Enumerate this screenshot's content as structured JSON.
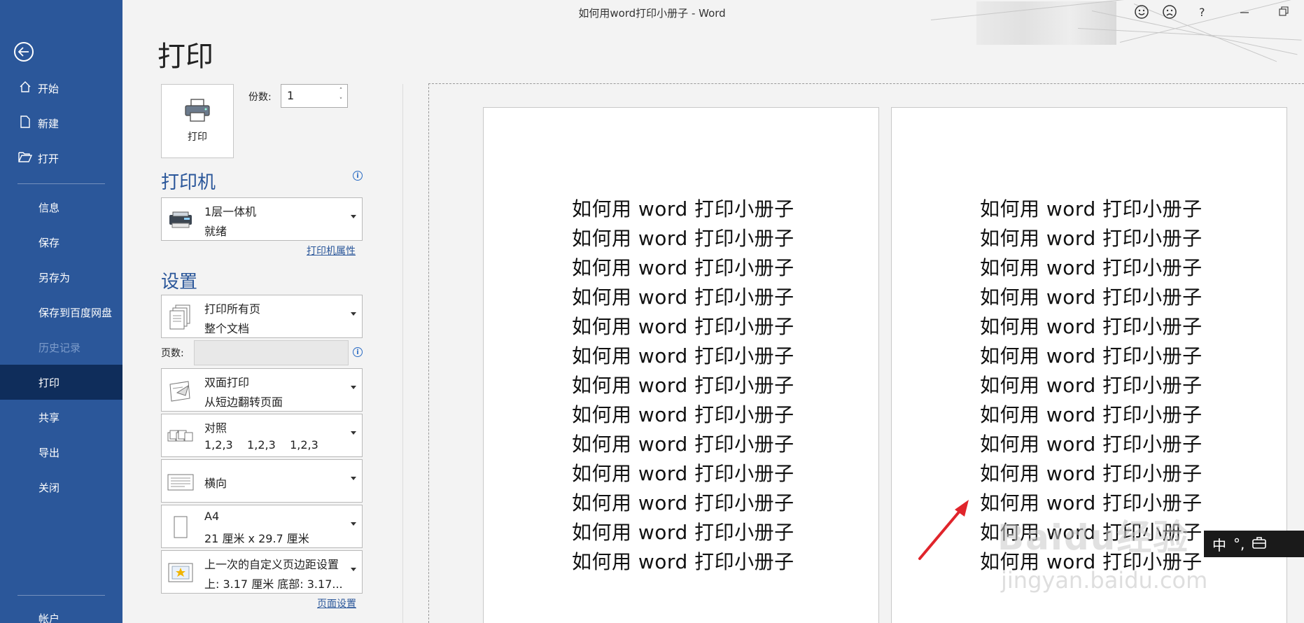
{
  "window": {
    "title": "如何用word打印小册子 - Word",
    "icons": [
      "smile-icon",
      "frown-icon",
      "help-icon",
      "minimize-icon",
      "restore-icon"
    ],
    "help_glyph": "?"
  },
  "sidebar": {
    "back_icon": "back-arrow-icon",
    "items": [
      {
        "label": "开始",
        "icon": "home-icon"
      },
      {
        "label": "新建",
        "icon": "new-document-icon"
      },
      {
        "label": "打开",
        "icon": "open-folder-icon"
      },
      {
        "label": "信息"
      },
      {
        "label": "保存"
      },
      {
        "label": "另存为"
      },
      {
        "label": "保存到百度网盘"
      },
      {
        "label": "历史记录"
      },
      {
        "label": "打印"
      },
      {
        "label": "共享"
      },
      {
        "label": "导出"
      },
      {
        "label": "关闭"
      },
      {
        "label": "帐户"
      }
    ],
    "active": "打印",
    "colors": {
      "bg": "#2b579a",
      "active": "#0f2d5b"
    }
  },
  "print_panel": {
    "heading": "打印",
    "print_button": "打印",
    "copies_label": "份数:",
    "copies_value": "1",
    "printer_section": "打印机",
    "printer": {
      "name": "1层一体机",
      "status": "就绪"
    },
    "printer_properties": "打印机属性",
    "settings_section": "设置",
    "range": {
      "line1": "打印所有页",
      "line2": "整个文档"
    },
    "pages_label": "页数:",
    "pages_value": "",
    "duplex": {
      "line1": "双面打印",
      "line2": "从短边翻转页面"
    },
    "collate": {
      "line1": "对照",
      "line2": "1,2,3    1,2,3    1,2,3"
    },
    "orientation": {
      "line1": "横向"
    },
    "paper": {
      "line1": "A4",
      "line2": "21 厘米 x 29.7 厘米"
    },
    "margins": {
      "line1": "上一次的自定义页边距设置",
      "line2": "上: 3.17 厘米 底部: 3.17..."
    },
    "page_setup": "页面设置"
  },
  "preview": {
    "left_page_lines": [
      "如何用 word 打印小册子",
      "如何用 word 打印小册子",
      "如何用 word 打印小册子",
      "如何用 word 打印小册子",
      "如何用 word 打印小册子",
      "如何用 word 打印小册子",
      "如何用 word 打印小册子",
      "如何用 word 打印小册子",
      "如何用 word 打印小册子",
      "如何用 word 打印小册子",
      "如何用 word 打印小册子",
      "如何用 word 打印小册子",
      "如何用 word 打印小册子"
    ],
    "right_page_lines": [
      "如何用 word 打印小册子",
      "如何用 word 打印小册子",
      "如何用 word 打印小册子",
      "如何用 word 打印小册子",
      "如何用 word 打印小册子",
      "如何用 word 打印小册子",
      "如何用 word 打印小册子",
      "如何用 word 打印小册子",
      "如何用 word 打印小册子",
      "如何用 word 打印小册子",
      "如何用 word 打印小册子",
      "如何用 word 打印小册子",
      "如何用 word 打印小册子"
    ],
    "annotation_color": "#e0242b"
  },
  "overlay": {
    "watermark_brand": "Baidu经验",
    "watermark_url": "jingyan.baidu.com",
    "ime": {
      "mode": "中",
      "punct": "°,",
      "toolbox_icon": "toolbox-icon"
    }
  }
}
